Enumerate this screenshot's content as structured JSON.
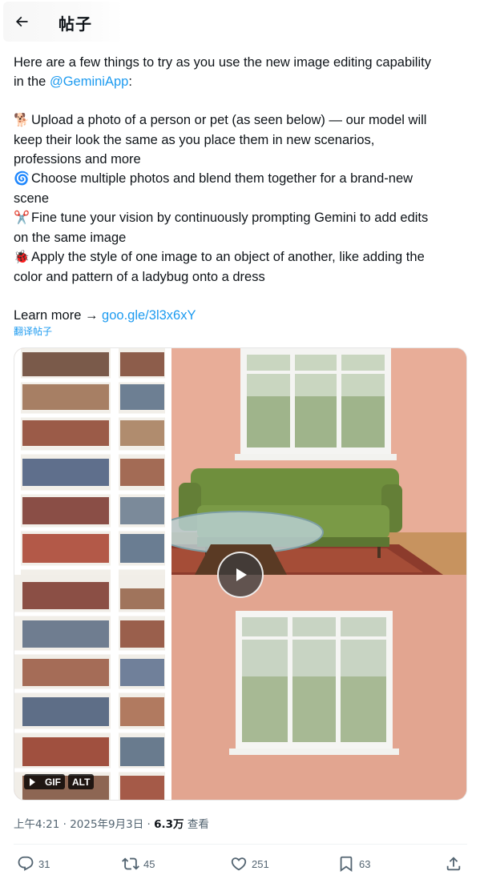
{
  "header": {
    "title": "帖子",
    "back_icon": "arrow-left-icon"
  },
  "post": {
    "line1": "Here are a few things to try as you use the new image editing capability",
    "line2_prefix": "in the ",
    "line2_mention": "@GeminiApp",
    "line2_suffix": ":",
    "items": [
      {
        "emoji": "🐕",
        "icon": "dog-emoji",
        "lines": [
          "Upload a photo of a person or pet (as seen below) — our model will",
          "keep their look the same as you place them in new scenarios,",
          "professions and more"
        ]
      },
      {
        "emoji": "🌀",
        "icon": "cyclone-emoji",
        "lines": [
          "Choose multiple photos and blend them together for a brand-new",
          "scene"
        ]
      },
      {
        "emoji": "✂️",
        "icon": "scissors-emoji",
        "lines": [
          "Fine tune your vision by continuously prompting Gemini to add edits",
          "on the same image"
        ]
      },
      {
        "emoji": "🐞",
        "icon": "ladybug-emoji",
        "lines": [
          "Apply the style of one image to an object of another, like adding the",
          "color and pattern of a ladybug onto a dress"
        ]
      }
    ],
    "learn_more_prefix": "Learn more → ",
    "learn_more_link": "goo.gle/3l3x6xY",
    "translate": "翻译帖子"
  },
  "media": {
    "gif_label": "GIF",
    "alt_label": "ALT",
    "play_icon": "play-icon"
  },
  "meta": {
    "time": "上午4:21",
    "sep1": " · ",
    "date": "2025年9月3日",
    "sep2": " · ",
    "views_count": "6.3万",
    "views_label": " 查看"
  },
  "actions": {
    "replies": "31",
    "reposts": "45",
    "likes": "251",
    "bookmarks": "63"
  },
  "colors": {
    "accent": "#1d9bf0",
    "muted": "#536471",
    "wall": "#e2a48f",
    "sofa": "#6e8e3e"
  }
}
